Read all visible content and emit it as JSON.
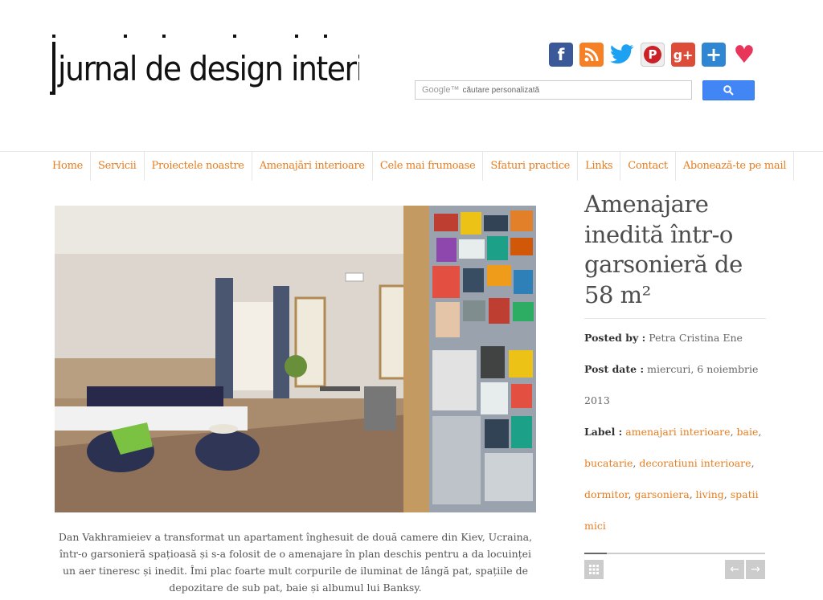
{
  "site": {
    "logo_text": "jurnal de design interior"
  },
  "social": {
    "icons": [
      "facebook-icon",
      "rss-icon",
      "twitter-icon",
      "pinterest-icon",
      "google-plus-icon",
      "add-plus-icon",
      "heart-icon"
    ]
  },
  "search": {
    "brand": "Google™",
    "placeholder": "căutare personalizată"
  },
  "nav": {
    "items": [
      "Home",
      "Servicii",
      "Proiectele noastre",
      "Amenajări interioare",
      "Cele mai frumoase",
      "Sfaturi practice",
      "Links",
      "Contact",
      "Abonează-te pe mail"
    ]
  },
  "post": {
    "title": "Amenajare inedită într-o garsonieră de 58 m²",
    "posted_by_label": "Posted by :",
    "author": "Petra Cristina Ene",
    "post_date_label": "Post date :",
    "date": "miercuri, 6 noiembrie 2013",
    "label_label": "Label :",
    "labels": [
      "amenajari interioare",
      "baie",
      "bucatarie",
      "decoratiuni interioare",
      "dormitor",
      "garsoniera",
      "living",
      "spatii mici"
    ],
    "caption": "Dan Vakhramieiev a transformat un apartament înghesuit de două camere din Kiev, Ucraina, într-o garsonieră spațioasă și s-a folosit de o amenajare în plan deschis pentru a da locuinței un aer tineresc și inedit. Îmi plac foarte mult corpurile de iluminat de lângă pat, spațiile de depozitare de sub pat, baie și albumul lui Banksy."
  },
  "pager": {
    "prev": "←",
    "next": "→"
  },
  "colors": {
    "accent": "#e67e22",
    "search_button": "#4285f4"
  }
}
